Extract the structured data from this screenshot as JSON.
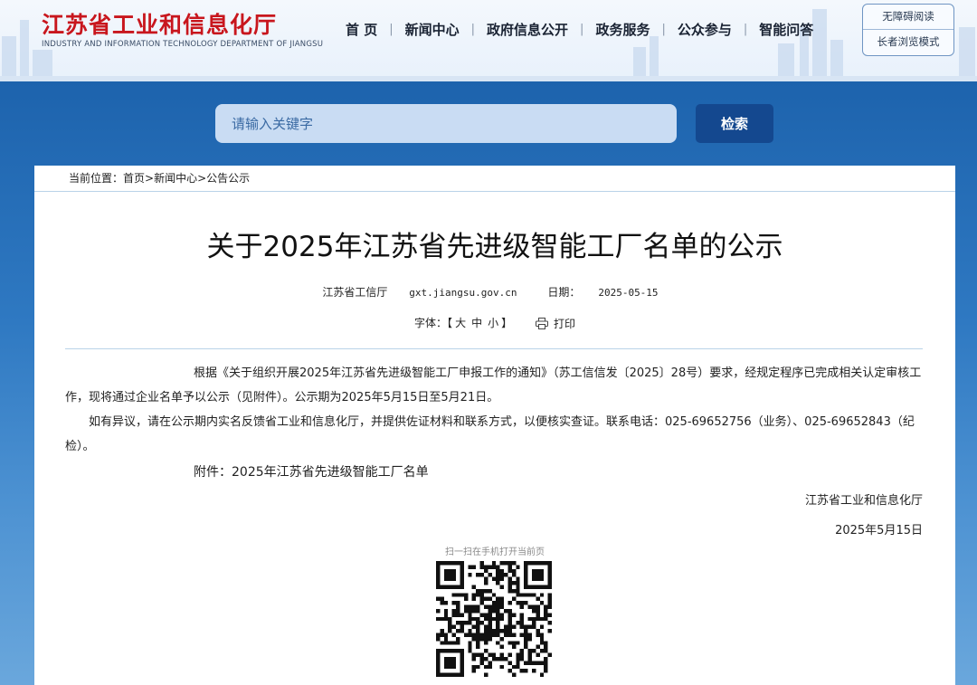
{
  "header": {
    "logo_cn": "江苏省工业和信息化厅",
    "logo_en": "INDUSTRY AND INFORMATION TECHNOLOGY DEPARTMENT OF JIANGSU",
    "nav": [
      "首 页",
      "新闻中心",
      "政府信息公开",
      "政务服务",
      "公众参与",
      "智能问答"
    ],
    "accessibility": [
      "无障碍阅读",
      "长者浏览模式"
    ]
  },
  "search": {
    "placeholder": "请输入关键字",
    "button": "检索"
  },
  "breadcrumb": {
    "prefix": "当前位置：",
    "items": [
      "首页",
      "新闻中心",
      "公告公示"
    ],
    "sep": ">"
  },
  "article": {
    "title": "关于2025年江苏省先进级智能工厂名单的公示",
    "source": "江苏省工信厅",
    "site": "gxt.jiangsu.gov.cn",
    "date_label": "日期：",
    "date": "2025-05-15",
    "font_label": "字体：",
    "bracket_open": "【",
    "font_sizes": [
      "大",
      "中",
      "小"
    ],
    "bracket_close": "】",
    "print": "打印",
    "para1": "根据《关于组织开展2025年江苏省先进级智能工厂申报工作的通知》（苏工信信发〔2025〕28号）要求，经规定程序已完成相关认定审核工作，现将通过企业名单予以公示（见附件）。公示期为2025年5月15日至5月21日。",
    "para2": "如有异议，请在公示期内实名反馈省工业和信息化厅，并提供佐证材料和联系方式，以便核实查证。联系电话：025-69652756（业务）、025-69652843（纪检）。",
    "attachment_label": "附件：",
    "attachment": "2025年江苏省先进级智能工厂名单",
    "signature": "江苏省工业和信息化厅",
    "sign_date": "2025年5月15日",
    "qr_caption": "扫一扫在手机打开当前页"
  },
  "colors": {
    "brand_red": "#c8161d",
    "band_blue": "#1d63ad",
    "button_blue": "#14488f"
  }
}
